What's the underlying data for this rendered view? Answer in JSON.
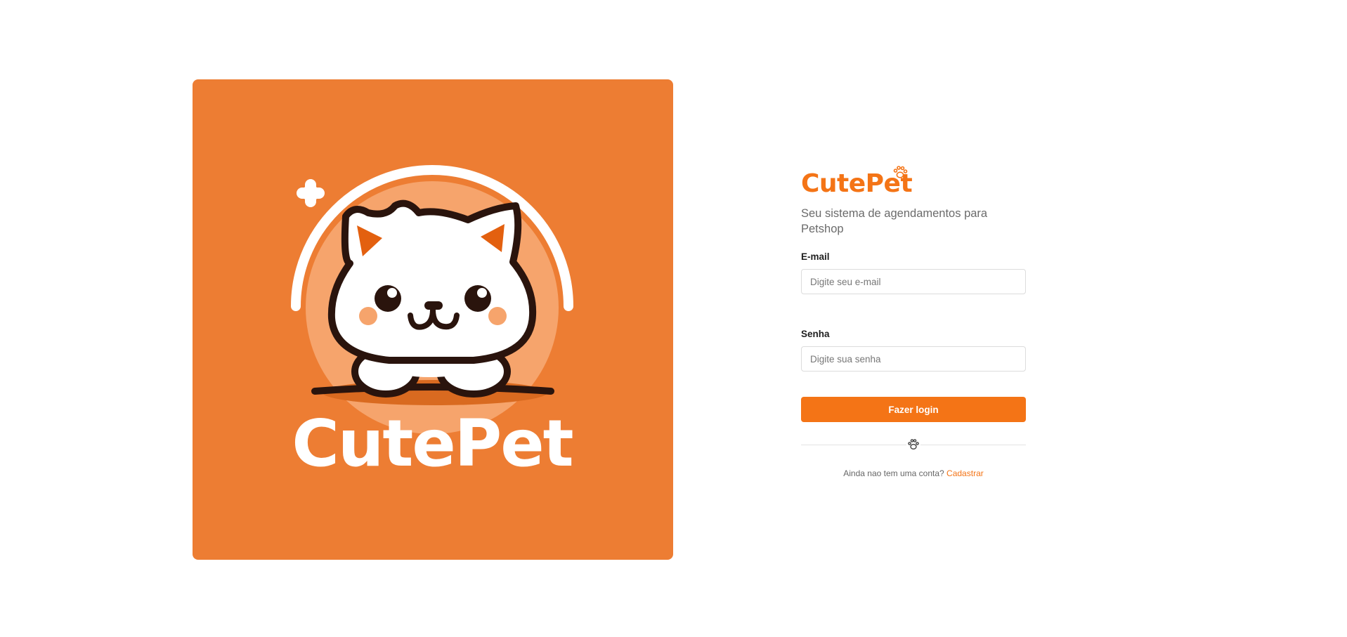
{
  "hero": {
    "logo_text": "CutePet",
    "colors": {
      "background": "#ed7d33",
      "halo": "#f6a46c",
      "outline": "#2a140d"
    }
  },
  "login": {
    "brand": "CutePet",
    "brand_icon": "paw-icon",
    "tagline": "Seu sistema de agendamentos para Petshop",
    "email_label": "E-mail",
    "email_placeholder": "Digite seu e-mail",
    "email_value": "",
    "password_label": "Senha",
    "password_placeholder": "Digite sua senha",
    "password_value": "",
    "submit_label": "Fazer login",
    "divider_icon": "paw-icon",
    "signup_prompt": "Ainda nao tem uma conta?",
    "signup_link": "Cadastrar",
    "accent": "#f47416"
  }
}
